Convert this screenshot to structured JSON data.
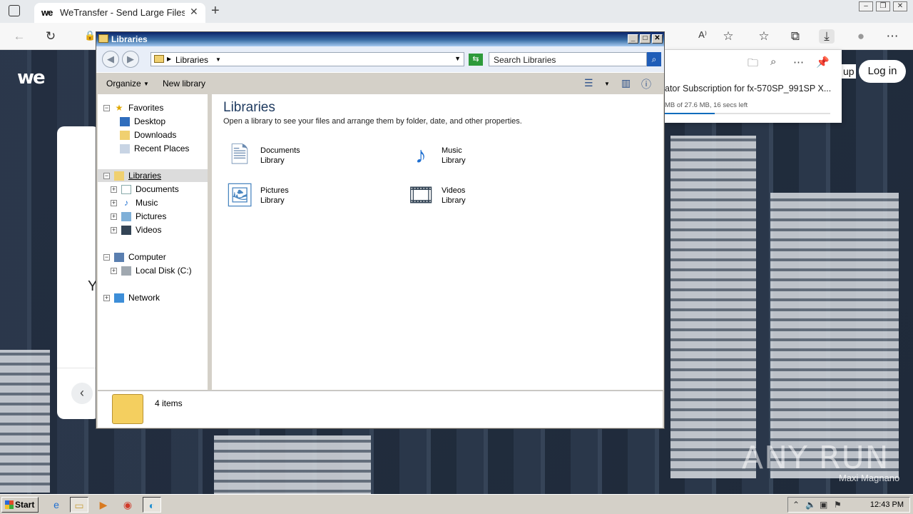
{
  "browser": {
    "tab_title": "WeTransfer - Send Large Files & Sh",
    "tab_favicon": "we",
    "tab_close": "✕",
    "new_tab": "+"
  },
  "wetransfer": {
    "logo": "we",
    "signup_label": "up",
    "login_label": "Log in",
    "partial_text": "Y"
  },
  "downloads": {
    "file_name": "ator Subscription for fx-570SP_991SP X...",
    "status": "MB of 27.6 MB, 16 secs left",
    "progress_fraction": 0.3
  },
  "explorer": {
    "title": "Libraries",
    "address": "Libraries",
    "search_placeholder": "Search Libraries",
    "commands": {
      "organize": "Organize",
      "new_library": "New library"
    },
    "tree": {
      "favorites": "Favorites",
      "desktop": "Desktop",
      "downloads": "Downloads",
      "recent_places": "Recent Places",
      "libraries": "Libraries",
      "documents": "Documents",
      "music": "Music",
      "pictures": "Pictures",
      "videos": "Videos",
      "computer": "Computer",
      "local_disk": "Local Disk (C:)",
      "network": "Network"
    },
    "content": {
      "heading": "Libraries",
      "description": "Open a library to see your files and arrange them by folder, date, and other properties.",
      "items": [
        {
          "name": "Documents",
          "type": "Library",
          "icon": "documents-icon"
        },
        {
          "name": "Music",
          "type": "Library",
          "icon": "music-icon"
        },
        {
          "name": "Pictures",
          "type": "Library",
          "icon": "pictures-icon"
        },
        {
          "name": "Videos",
          "type": "Library",
          "icon": "videos-icon"
        }
      ]
    },
    "status": "4 items"
  },
  "taskbar": {
    "start_label": "Start",
    "clock": "12:43 PM"
  },
  "watermark": {
    "brand": "ANY RUN",
    "credit": "Maxi Magnano"
  },
  "colors": {
    "title_bar": "#0a246a",
    "accent": "#0f6cbd",
    "heading": "#1e3a5f"
  }
}
